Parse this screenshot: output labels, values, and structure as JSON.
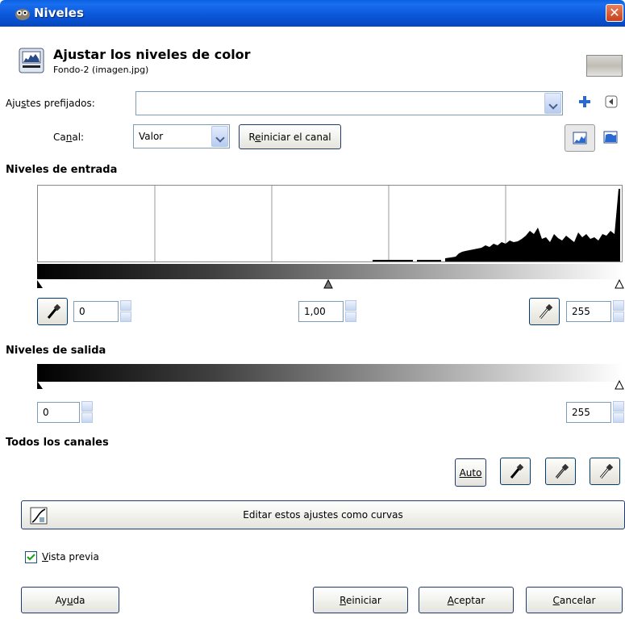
{
  "window": {
    "title": "Niveles",
    "close_glyph": "✕"
  },
  "header": {
    "title": "Ajustar los niveles de color",
    "subtitle": "Fondo-2 (imagen.jpg)"
  },
  "presets": {
    "label_pre": "Aju",
    "label_ul": "s",
    "label_post": "tes prefijados:",
    "value": ""
  },
  "channel": {
    "label_pre": "Ca",
    "label_ul": "n",
    "label_post": "al:",
    "value": "Valor",
    "reset_pre": "R",
    "reset_ul": "e",
    "reset_post": "iniciar el canal"
  },
  "input_levels": {
    "title": "Niveles de entrada",
    "low": "0",
    "gamma": "1,00",
    "high": "255"
  },
  "output_levels": {
    "title": "Niveles de salida",
    "low": "0",
    "high": "255"
  },
  "all_channels": {
    "title": "Todos los canales",
    "auto_label": "Auto"
  },
  "curves_button": {
    "label": "Editar estos ajustes como curvas"
  },
  "preview": {
    "label_pre": "",
    "label_ul": "V",
    "label_post": "ista previa",
    "checked": true
  },
  "buttons": {
    "help_pre": "Ay",
    "help_ul": "u",
    "help_post": "da",
    "reset_ul": "R",
    "reset_post": "einiciar",
    "accept_ul": "A",
    "accept_post": "ceptar",
    "cancel_ul": "C",
    "cancel_post": "ancelar"
  },
  "colors": {
    "titlebar": "#0a56d8",
    "accent": "#316ac5"
  }
}
